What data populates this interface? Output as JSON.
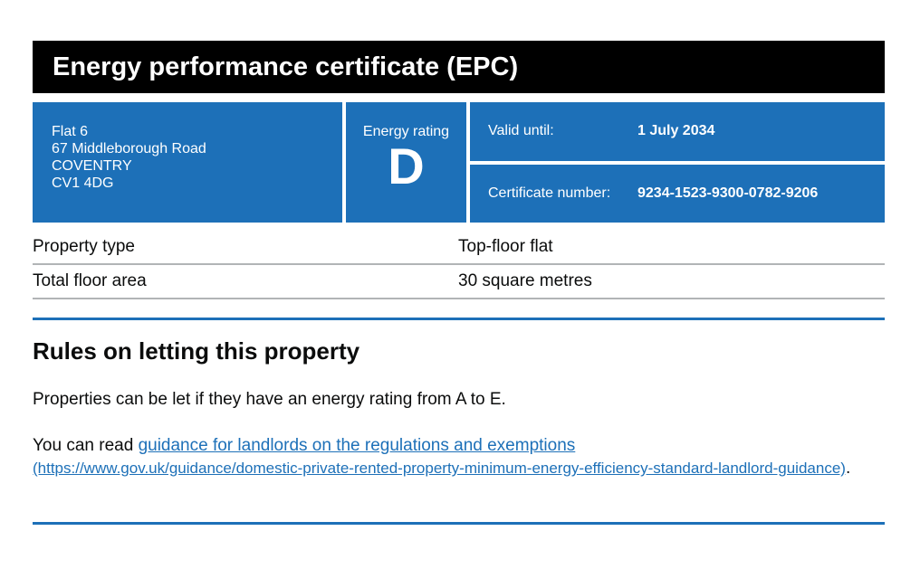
{
  "header": {
    "title": "Energy performance certificate (EPC)"
  },
  "summary": {
    "address": [
      "Flat 6",
      "67 Middleborough Road",
      "COVENTRY",
      "CV1 4DG"
    ],
    "rating_label": "Energy rating",
    "rating_letter": "D",
    "valid_until_label": "Valid until:",
    "valid_until_value": "1 July 2034",
    "certificate_number_label": "Certificate number:",
    "certificate_number_value": "9234-1523-9300-0782-9206"
  },
  "property": [
    {
      "label": "Property type",
      "value": "Top-floor flat"
    },
    {
      "label": "Total floor area",
      "value": "30 square metres"
    }
  ],
  "letting": {
    "heading": "Rules on letting this property",
    "paragraph1": "Properties can be let if they have an energy rating from A to E.",
    "paragraph2_prefix": "You can read ",
    "link_text": "guidance for landlords on the regulations and exemptions",
    "link_url_text": "(https://www.gov.uk/guidance/domestic-private-rented-property-minimum-energy-efficiency-standard-landlord-guidance)",
    "paragraph2_suffix": "."
  },
  "colors": {
    "brand_blue": "#1d70b8",
    "title_bar": "#000000",
    "rule_grey": "#b1b4b6"
  }
}
